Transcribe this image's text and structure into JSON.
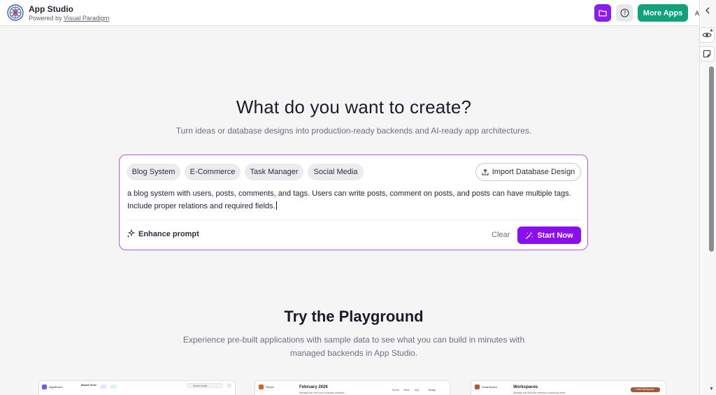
{
  "header": {
    "app_title": "App Studio",
    "powered_prefix": "Powered by ",
    "powered_link": "Visual Paradigm",
    "more_apps_label": "More Apps",
    "help_label": "?",
    "edge_glyph": "A"
  },
  "hero": {
    "title": "What do you want to create?",
    "subtitle": "Turn ideas or database designs into production-ready backends and AI-ready app architectures."
  },
  "prompt_card": {
    "chips": [
      "Blog System",
      "E-Commerce",
      "Task Manager",
      "Social Media"
    ],
    "import_label": "Import Database Design",
    "prompt_value": "a blog system with users, posts, comments, and tags. Users can write posts, comment on posts, and posts can have multiple tags. Include proper relations and required fields.",
    "enhance_label": "Enhance prompt",
    "clear_label": "Clear",
    "start_label": "Start Now"
  },
  "playground": {
    "title": "Try the Playground",
    "subtitle": "Experience pre-built applications with sample data to see what you can build in minutes with managed backends in App Studio.",
    "previews": [
      {
        "app": "AgileBoard",
        "view": "Board View",
        "search_placeholder": "Search tasks..."
      },
      {
        "app": "Tempo",
        "heading": "February 2026",
        "caption": "Manage and view your schedule activities",
        "tabs": [
          "Month",
          "Week",
          "Day"
        ],
        "today_label": "Today"
      },
      {
        "app": "SmartSpace",
        "heading": "Workspaces",
        "caption": "Manage and discover premium coworking areas",
        "action_label": "+ Add Workspace"
      }
    ]
  },
  "colors": {
    "accent_purple": "#8a0ef0",
    "card_border": "#b454f5",
    "more_apps_green": "#12a27a",
    "folder_purple": "#8a1cf0"
  },
  "icons": {
    "logo": "app-studio-globe-logo",
    "folder": "folder-icon",
    "help": "help-circle-icon",
    "rail_toggle": "chevron-left-icon",
    "rail_preview": "eye-icon",
    "rail_notes": "sticky-note-icon",
    "import": "upload-icon",
    "enhance": "sparkles-icon",
    "start": "magic-wand-icon"
  }
}
